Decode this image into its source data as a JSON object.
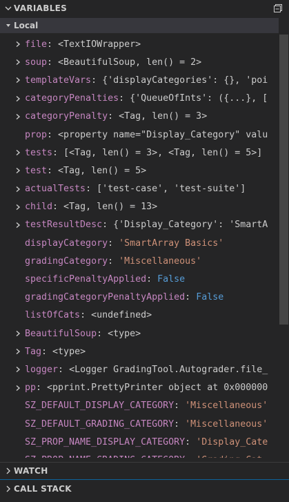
{
  "panel": {
    "title": "VARIABLES"
  },
  "local": {
    "label": "Local"
  },
  "variables": [
    {
      "name": "file",
      "value": "<TextIOWrapper>",
      "kind": "obj",
      "expandable": true
    },
    {
      "name": "soup",
      "value": "<BeautifulSoup, len() = 2>",
      "kind": "obj",
      "expandable": true
    },
    {
      "name": "templateVars",
      "value": "{'displayCategories': {}, 'poi",
      "kind": "obj",
      "expandable": true
    },
    {
      "name": "categoryPenalties",
      "value": "{'QueueOfInts': ({...}, [",
      "kind": "obj",
      "expandable": true
    },
    {
      "name": "categoryPenalty",
      "value": "<Tag, len() = 3>",
      "kind": "obj",
      "expandable": true
    },
    {
      "name": "prop",
      "value": "<property name=\"Display_Category\" valu",
      "kind": "obj",
      "expandable": false
    },
    {
      "name": "tests",
      "value": "[<Tag, len() = 3>, <Tag, len() = 5>]",
      "kind": "obj",
      "expandable": true
    },
    {
      "name": "test",
      "value": "<Tag, len() = 5>",
      "kind": "obj",
      "expandable": true
    },
    {
      "name": "actualTests",
      "value": "['test-case', 'test-suite']",
      "kind": "obj",
      "expandable": true
    },
    {
      "name": "child",
      "value": "<Tag, len() = 13>",
      "kind": "obj",
      "expandable": true
    },
    {
      "name": "testResultDesc",
      "value": "{'Display_Category': 'SmartA",
      "kind": "obj",
      "expandable": true
    },
    {
      "name": "displayCategory",
      "value": "'SmartArray Basics'",
      "kind": "str",
      "expandable": false
    },
    {
      "name": "gradingCategory",
      "value": "'Miscellaneous'",
      "kind": "str",
      "expandable": false
    },
    {
      "name": "specificPenaltyApplied",
      "value": "False",
      "kind": "bool",
      "expandable": false
    },
    {
      "name": "gradingCategoryPenaltyApplied",
      "value": "False",
      "kind": "bool",
      "expandable": false
    },
    {
      "name": "listOfCats",
      "value": "<undefined>",
      "kind": "obj",
      "expandable": false
    },
    {
      "name": "BeautifulSoup",
      "value": "<type>",
      "kind": "obj",
      "expandable": true
    },
    {
      "name": "Tag",
      "value": "<type>",
      "kind": "obj",
      "expandable": true
    },
    {
      "name": "logger",
      "value": "<Logger GradingTool.Autograder.file_",
      "kind": "obj",
      "expandable": true
    },
    {
      "name": "pp",
      "value": "<pprint.PrettyPrinter object at 0x000000",
      "kind": "obj",
      "expandable": true
    },
    {
      "name": "SZ_DEFAULT_DISPLAY_CATEGORY",
      "value": "'Miscellaneous'",
      "kind": "str",
      "expandable": false
    },
    {
      "name": "SZ_DEFAULT_GRADING_CATEGORY",
      "value": "'Miscellaneous'",
      "kind": "str",
      "expandable": false
    },
    {
      "name": "SZ_PROP_NAME_DISPLAY_CATEGORY",
      "value": "'Display_Cate",
      "kind": "str",
      "expandable": false
    },
    {
      "name": "SZ_PROP_NAME_GRADING_CATEGORY",
      "value": "'Grading_Cat",
      "kind": "str",
      "expandable": false
    }
  ],
  "watch": {
    "label": "WATCH"
  },
  "callstack": {
    "label": "CALL STACK"
  },
  "colors": {
    "name": "#c586c0",
    "string": "#ce9178",
    "boolean": "#569cd6",
    "text": "#cccccc",
    "background": "#252526",
    "section_header": "#37373d"
  }
}
